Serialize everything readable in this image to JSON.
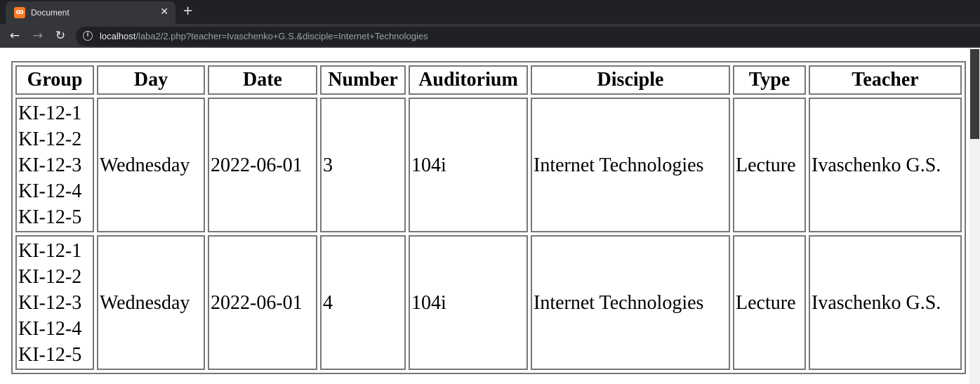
{
  "browser": {
    "tab_title": "Document",
    "tab_close": "✕",
    "new_tab": "+",
    "back": "←",
    "forward": "→",
    "reload": "↻",
    "info": "i",
    "url_host": "localhost",
    "url_path": "/laba2/2.php?teacher=Ivaschenko+G.S.&disciple=Internet+Technologies"
  },
  "table": {
    "headers": [
      "Group",
      "Day",
      "Date",
      "Number",
      "Auditorium",
      "Disciple",
      "Type",
      "Teacher"
    ],
    "rows": [
      {
        "groups": [
          "KI-12-1",
          "KI-12-2",
          "KI-12-3",
          "KI-12-4",
          "KI-12-5"
        ],
        "day": "Wednesday",
        "date": "2022-06-01",
        "number": "3",
        "auditorium": "104i",
        "disciple": "Internet Technologies",
        "type": "Lecture",
        "teacher": "Ivaschenko G.S."
      },
      {
        "groups": [
          "KI-12-1",
          "KI-12-2",
          "KI-12-3",
          "KI-12-4",
          "KI-12-5"
        ],
        "day": "Wednesday",
        "date": "2022-06-01",
        "number": "4",
        "auditorium": "104i",
        "disciple": "Internet Technologies",
        "type": "Lecture",
        "teacher": "Ivaschenko G.S."
      }
    ]
  }
}
